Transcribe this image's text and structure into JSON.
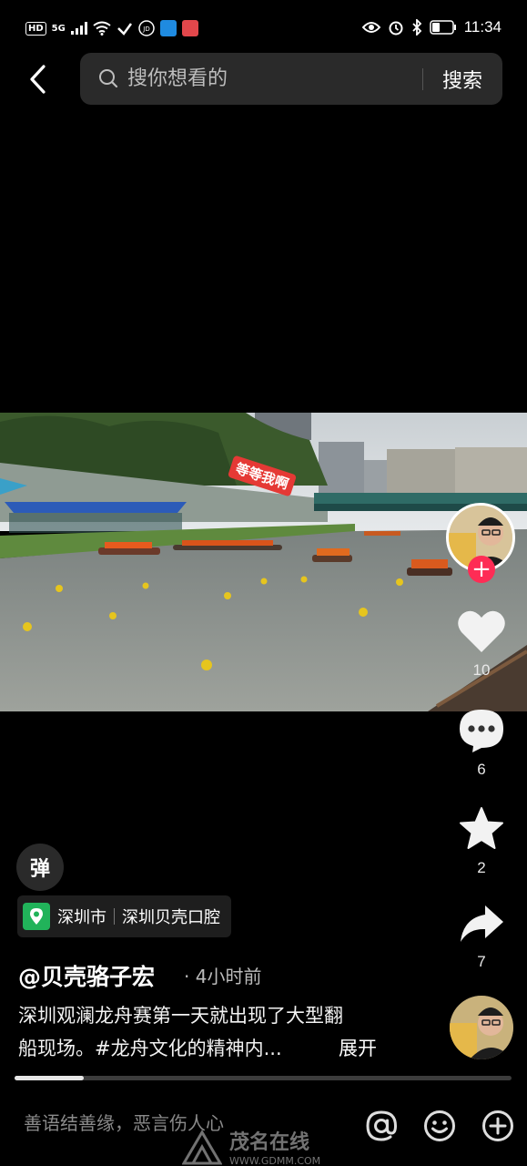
{
  "status_bar": {
    "hd": "HD",
    "signal": "5G",
    "time": "11:34"
  },
  "header": {
    "back_icon": "chevron-left-icon",
    "search_placeholder": "搜你想看的",
    "search_button": "搜索"
  },
  "video": {
    "danmaku_text": "等等我啊",
    "danmaku_color": "#e53935"
  },
  "actions": {
    "like_count": "10",
    "comment_count": "6",
    "favorite_count": "2",
    "share_count": "7",
    "follow_color": "#fe2c55"
  },
  "info": {
    "danmaku_toggle": "弹",
    "location_city": "深圳市",
    "location_place": "深圳贝壳口腔",
    "author": "@贝壳骆子宏",
    "time_ago": "· 4小时前",
    "caption_line1": "深圳观澜龙舟赛第一天就出现了大型翻",
    "caption_line2": "船现场。#龙舟文化的精神内...",
    "expand": "展开"
  },
  "progress": {
    "played_fraction": 0.14
  },
  "comment_bar": {
    "placeholder": "善语结善缘，恶言伤人心"
  },
  "watermark": {
    "text": "茂名在线",
    "url": "WWW.GDMM.COM"
  }
}
